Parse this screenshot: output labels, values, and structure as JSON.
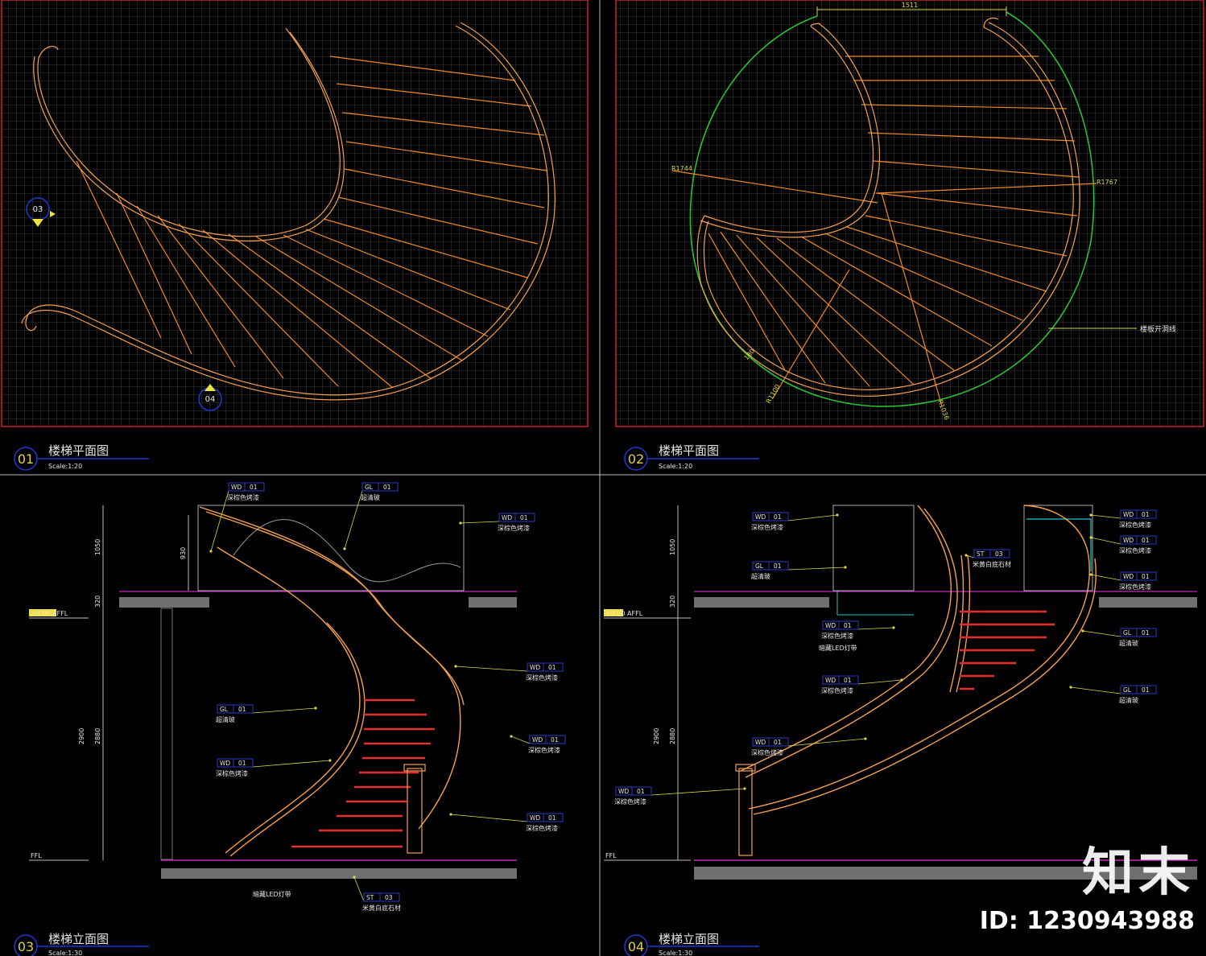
{
  "colors": {
    "background": "#000000",
    "grid": "#3a3a3a",
    "frame": "#c8232c",
    "stair": "#f08a24",
    "handrail": "#f5a050",
    "green_outline": "#26c236",
    "dimension": "#d9d940",
    "blue_mark": "#1c3ad6",
    "label_text": "#e6e6e6",
    "tag_box": "#2a3cc8",
    "floor_slab": "#6f6f6f",
    "floor_line": "#c028c0",
    "step_red": "#e03030",
    "cyan": "#20c8c8"
  },
  "panels": [
    {
      "number": "01",
      "title": "楼梯平面图",
      "scale": "Scale:1:20",
      "section_marks": [
        "03",
        "04"
      ]
    },
    {
      "number": "02",
      "title": "楼梯平面图",
      "scale": "Scale:1:20",
      "dims": {
        "top": "1511",
        "r_left": "R1744",
        "r_right": "R1767",
        "r_bottom1": "R1100",
        "r_bottom2": "R1036",
        "r_small": "180"
      },
      "note": "楼板开洞线"
    },
    {
      "number": "03",
      "title": "楼梯立面图",
      "scale": "Scale:1:30",
      "levels": {
        "upper": "±0.00 AFFL",
        "lower": "FFL"
      },
      "vert_dims": [
        "1050",
        "930",
        "320",
        "2900",
        "2880"
      ],
      "tags": [
        {
          "code": "WD",
          "num": "01",
          "desc": "深棕色烤漆"
        },
        {
          "code": "GL",
          "num": "01",
          "desc": "超清玻"
        },
        {
          "code": "WD",
          "num": "01",
          "desc": "深棕色烤漆"
        },
        {
          "code": "WD",
          "num": "01",
          "desc": "深棕色烤漆"
        },
        {
          "code": "GL",
          "num": "01",
          "desc": "超清玻"
        },
        {
          "code": "WD",
          "num": "01",
          "desc": "深棕色烤漆"
        },
        {
          "code": "WD",
          "num": "01",
          "desc": "深棕色烤漆"
        },
        {
          "code": "WD",
          "num": "01",
          "desc": "深棕色烤漆"
        },
        {
          "code": "ST",
          "num": "03",
          "desc": "米黄白底石材"
        }
      ],
      "led_note": "暗藏LED灯带"
    },
    {
      "number": "04",
      "title": "楼梯立面图",
      "scale": "Scale:1:30",
      "levels": {
        "upper": "±0.00 AFFL",
        "lower": "FFL"
      },
      "vert_dims": [
        "1050",
        "320",
        "2900",
        "2880"
      ],
      "tags": [
        {
          "code": "WD",
          "num": "01",
          "desc": "深棕色烤漆"
        },
        {
          "code": "GL",
          "num": "01",
          "desc": "超清玻"
        },
        {
          "code": "ST",
          "num": "03",
          "desc": "米黄白底石材"
        },
        {
          "code": "WD",
          "num": "01",
          "desc": "深棕色烤漆"
        },
        {
          "code": "WD",
          "num": "01",
          "desc": "深棕色烤漆"
        },
        {
          "code": "WD",
          "num": "01",
          "desc": "深棕色烤漆"
        },
        {
          "code": "WD",
          "num": "01",
          "desc": "深棕色烤漆"
        },
        {
          "code": "WD",
          "num": "01",
          "desc": "深棕色烤漆"
        },
        {
          "code": "GL",
          "num": "01",
          "desc": "超清玻"
        },
        {
          "code": "WD",
          "num": "01",
          "desc": "深棕色烤漆"
        },
        {
          "code": "GL",
          "num": "01",
          "desc": "超清玻"
        },
        {
          "code": "WD",
          "num": "01",
          "desc": "深棕色烤漆"
        }
      ],
      "led_note": "暗藏LED灯带"
    }
  ],
  "watermark": {
    "brand": "知末",
    "id": "ID: 1230943988"
  }
}
